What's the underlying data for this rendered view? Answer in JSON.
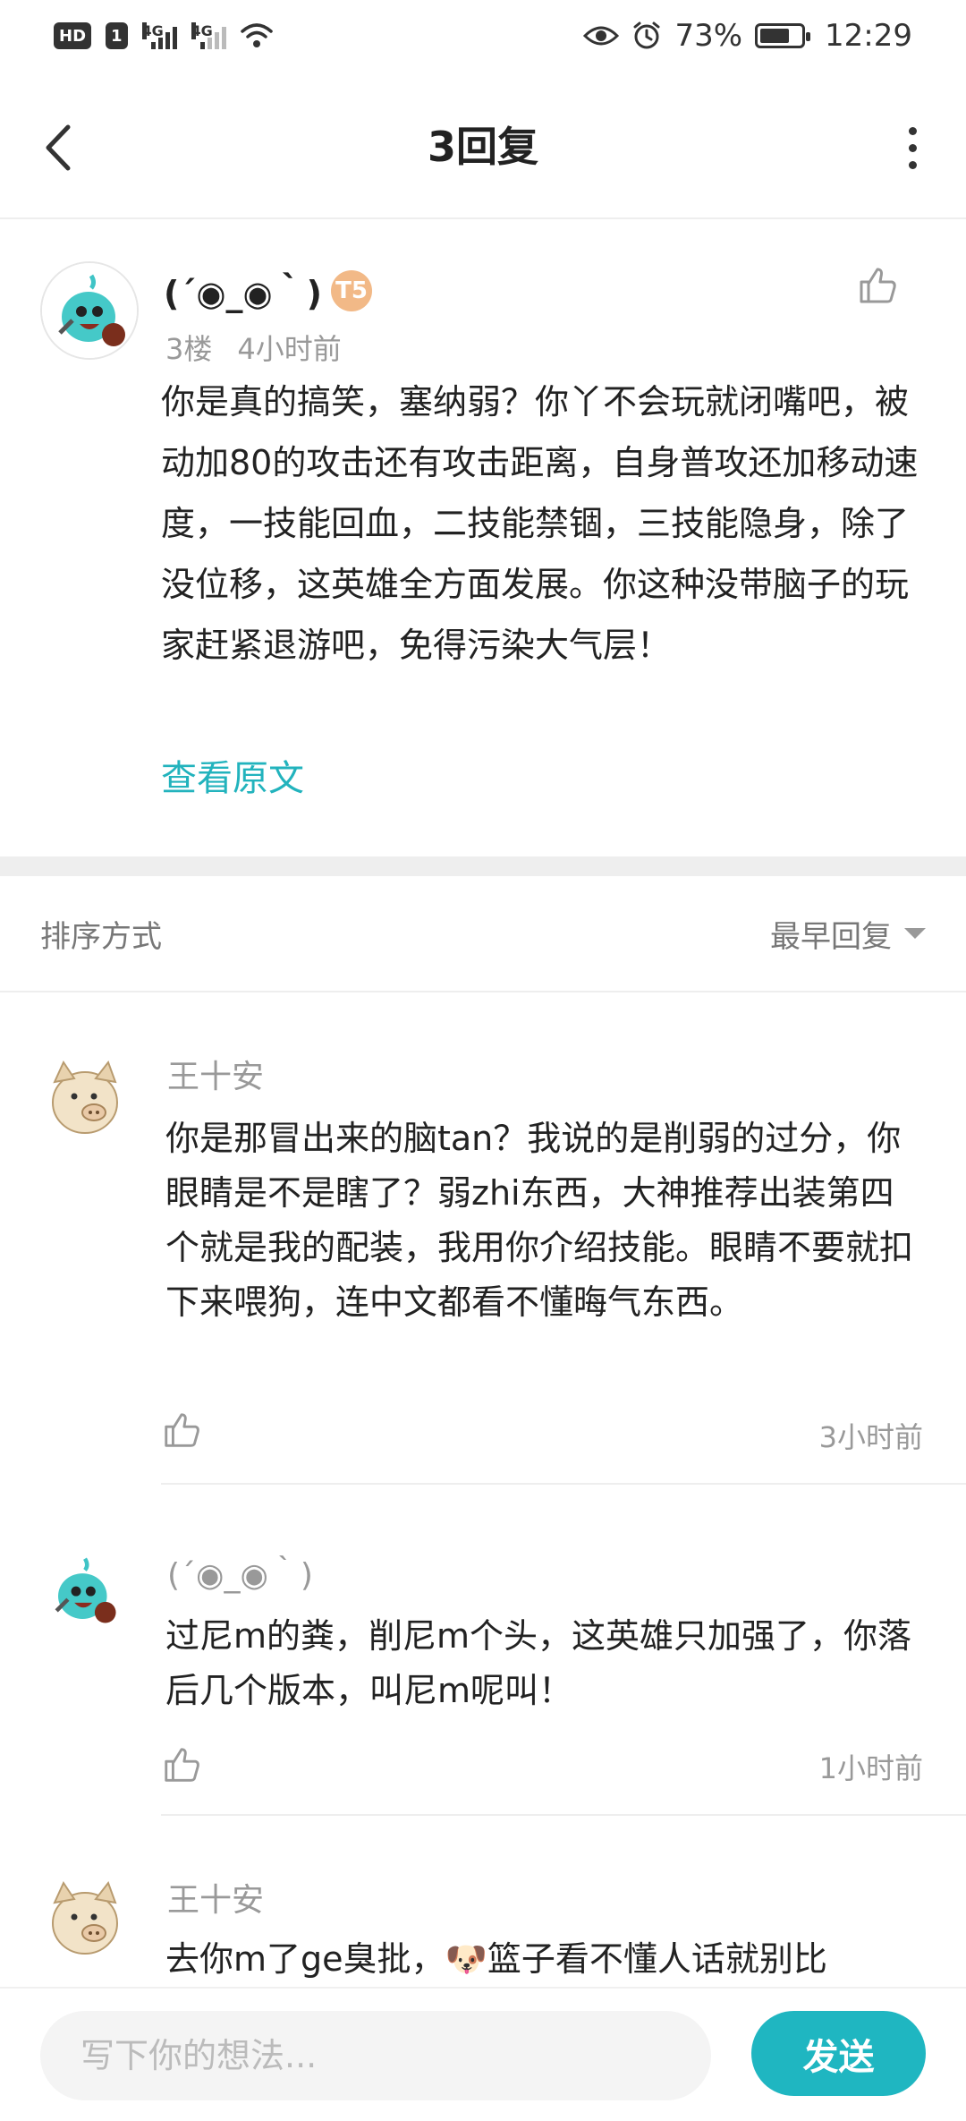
{
  "status_bar": {
    "hd_label": "HD",
    "sim_label": "1",
    "network_1": "4G",
    "network_2": "4G",
    "battery_percent": "73%",
    "battery_level": 0.73,
    "time": "12:29"
  },
  "header": {
    "title": "3回复"
  },
  "main_post": {
    "author": "(´◉_◉｀)",
    "level_badge": "T5",
    "floor": "3楼",
    "time": "4小时前",
    "content": "你是真的搞笑，塞纳弱？你丫不会玩就闭嘴吧，被动加80的攻击还有攻击距离，自身普攻还加移动速度，一技能回血，二技能禁锢，三技能隐身，除了没位移，这英雄全方面发展。你这种没带脑子的玩家赶紧退游吧，免得污染大气层！",
    "view_original": "查看原文"
  },
  "sort_bar": {
    "label": "排序方式",
    "selected": "最早回复"
  },
  "replies": [
    {
      "author": "王十安",
      "content": "你是那冒出来的脑tan？我说的是削弱的过分，你眼睛是不是瞎了？弱zhi东西，大神推荐出装第四个就是我的配装，我用你介绍技能。眼睛不要就扣下来喂狗，连中文都看不懂晦气东西。",
      "time": "3小时前"
    },
    {
      "author": "(´◉_◉｀)",
      "content": "过尼m的粪，削尼m个头，这英雄只加强了，你落后几个版本，叫尼m呢叫！",
      "time": "1小时前"
    },
    {
      "author": "王十安",
      "content": "去你m了ge臭批，🐶篮子看不懂人话就别比"
    }
  ],
  "bottom_bar": {
    "placeholder": "写下你的想法...",
    "send_label": "发送"
  },
  "colors": {
    "accent": "#1fb6c1",
    "link": "#22b3bd",
    "badge": "#f2b987"
  },
  "icons": [
    "back-arrow-icon",
    "more-dots-icon",
    "thumbs-up-icon",
    "eye-icon",
    "alarm-icon",
    "wifi-icon",
    "battery-icon",
    "sort-caret-icon"
  ]
}
